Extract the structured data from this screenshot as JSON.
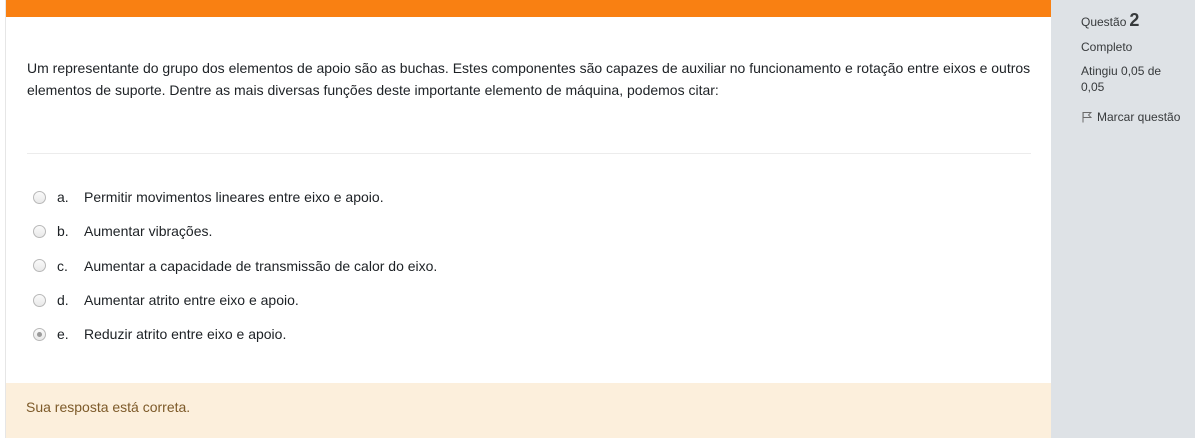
{
  "question": {
    "text": "Um representante do grupo dos elementos de apoio são as buchas. Estes componentes são capazes de auxiliar no funcionamento e rotação entre eixos e outros elementos de suporte. Dentre as mais diversas funções deste importante elemento de máquina, podemos citar:",
    "answers": [
      {
        "letter": "a.",
        "text": "Permitir movimentos lineares entre eixo e apoio.",
        "checked": false
      },
      {
        "letter": "b.",
        "text": "Aumentar vibrações.",
        "checked": false
      },
      {
        "letter": "c.",
        "text": "Aumentar a capacidade de transmissão de calor do eixo.",
        "checked": false
      },
      {
        "letter": "d.",
        "text": "Aumentar atrito entre eixo e apoio.",
        "checked": false
      },
      {
        "letter": "e.",
        "text": "Reduzir atrito entre eixo e apoio.",
        "checked": true
      }
    ],
    "feedback": "Sua resposta está correta."
  },
  "info": {
    "label": "Questão",
    "number": "2",
    "state": "Completo",
    "grade": "Atingiu 0,05 de 0,05",
    "flag_label": "Marcar questão",
    "flag_icon": "flag-icon"
  },
  "colors": {
    "accent": "#f98012",
    "feedback_bg": "#fcefdc",
    "feedback_text": "#7d5a29",
    "info_bg": "#dee2e6"
  }
}
